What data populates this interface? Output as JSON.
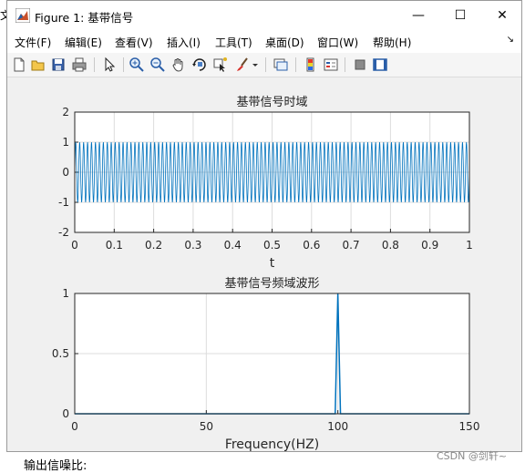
{
  "background": {
    "left_text": "文",
    "bottom_text": "输出信噪比:"
  },
  "window": {
    "title": "Figure 1: 基带信号",
    "minimize_symbol": "—",
    "maximize_symbol": "☐",
    "close_symbol": "✕"
  },
  "menu": {
    "items": [
      {
        "label": "文件(F)"
      },
      {
        "label": "编辑(E)"
      },
      {
        "label": "查看(V)"
      },
      {
        "label": "插入(I)"
      },
      {
        "label": "工具(T)"
      },
      {
        "label": "桌面(D)"
      },
      {
        "label": "窗口(W)"
      },
      {
        "label": "帮助(H)"
      }
    ],
    "pin_symbol": "↘"
  },
  "toolbar": {
    "icons": [
      "new-figure-icon",
      "open-folder-icon",
      "save-icon",
      "print-icon",
      "pointer-icon",
      "zoom-in-icon",
      "zoom-out-icon",
      "pan-hand-icon",
      "rotate-3d-icon",
      "data-cursor-icon",
      "brush-icon",
      "link-plot-icon",
      "colorbar-icon",
      "legend-icon",
      "hide-plot-tools-icon",
      "show-plot-tools-icon"
    ]
  },
  "colors": {
    "line": "#0072bd",
    "grid": "#dcdcdc",
    "axes_bg": "#ffffff",
    "figure_bg": "#f0f0f0"
  },
  "chart_data": [
    {
      "type": "line",
      "title": "基带信号时域",
      "xlabel": "t",
      "ylabel": "",
      "xlim": [
        0,
        1
      ],
      "ylim": [
        -2,
        2
      ],
      "xticks": [
        "0",
        "0.1",
        "0.2",
        "0.3",
        "0.4",
        "0.5",
        "0.6",
        "0.7",
        "0.8",
        "0.9",
        "1"
      ],
      "yticks": [
        "-2",
        "-1",
        "0",
        "1",
        "2"
      ],
      "grid": true,
      "signal": {
        "frequency": 100,
        "amplitude": 1
      }
    },
    {
      "type": "line",
      "title": "基带信号频域波形",
      "xlabel": "Frequency(HZ)",
      "ylabel": "",
      "xlim": [
        0,
        150
      ],
      "ylim": [
        0,
        1
      ],
      "xticks": [
        "0",
        "50",
        "100",
        "150"
      ],
      "yticks": [
        "0",
        "0.5",
        "1"
      ],
      "grid": true,
      "x": [
        0,
        98,
        99,
        100,
        101,
        102,
        150
      ],
      "y": [
        0,
        0,
        0,
        1,
        0,
        0,
        0
      ]
    }
  ],
  "watermark": "CSDN @剑轩~"
}
